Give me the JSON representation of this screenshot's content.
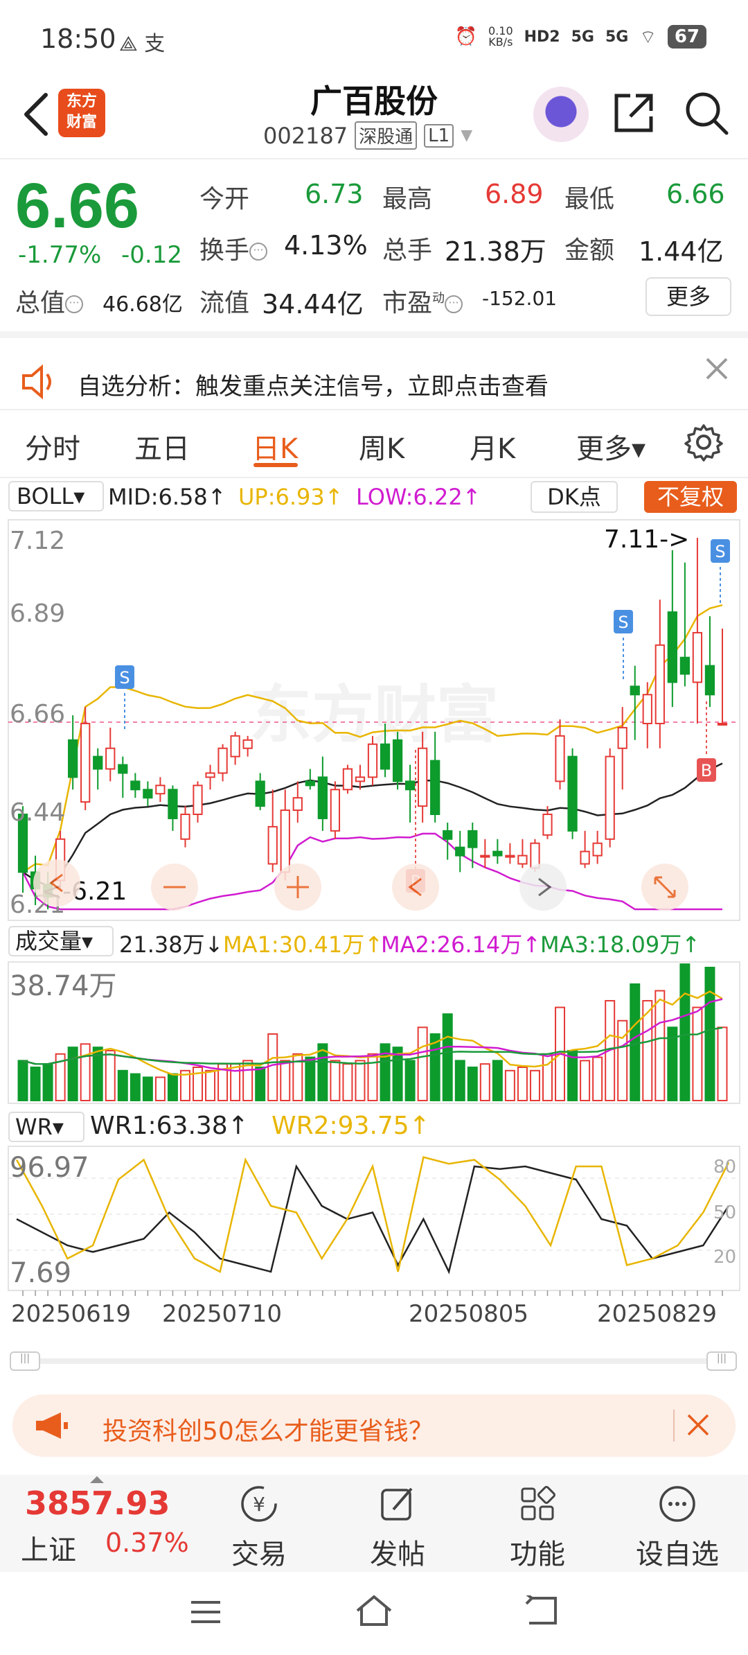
{
  "status_bar": {
    "time": "18:50",
    "left_icons": "⟁ 支",
    "net_speed_top": "0.10",
    "net_speed_bottom": "KB/s",
    "hd": "HD2",
    "sig1": "5G",
    "sig2": "5G",
    "battery": "67"
  },
  "header": {
    "logo_line1": "东方",
    "logo_line2": "财富",
    "title": "广百股份",
    "code": "002187",
    "market_tag": "深股通",
    "level_tag": "L1"
  },
  "quote": {
    "price": "6.66",
    "change_pct": "-1.77%",
    "change_abs": "-0.12",
    "open_label": "今开",
    "open_value": "6.73",
    "high_label": "最高",
    "high_value": "6.89",
    "low_label": "最低",
    "low_value": "6.66",
    "turnover_label": "换手",
    "turnover_value": "4.13%",
    "volume_label": "总手",
    "volume_value": "21.38万",
    "amount_label": "金额",
    "amount_value": "1.44亿",
    "mktcap_label": "总值",
    "mktcap_value": "46.68亿",
    "float_label": "流值",
    "float_value": "34.44亿",
    "pe_label": "市盈",
    "pe_sup": "动",
    "pe_value": "-152.01",
    "more_button": "更多"
  },
  "notice": {
    "text": "自选分析：触发重点关注信号，立即点击查看"
  },
  "tabs": [
    {
      "label": "分时"
    },
    {
      "label": "五日"
    },
    {
      "label": "日K"
    },
    {
      "label": "周K"
    },
    {
      "label": "月K"
    },
    {
      "label": "更多▾"
    }
  ],
  "indicator": {
    "boll_button": "BOLL▾",
    "mid": "MID:6.58↑",
    "up": "UP:6.93↑",
    "low": "LOW:6.22↑",
    "dk_button": "DK点",
    "nofq_button": "不复权",
    "boll_colors": {
      "mid": "#222222",
      "up": "#e8b500",
      "low": "#d01bd0"
    }
  },
  "kline": {
    "y_labels": [
      "7.12",
      "6.89",
      "6.66",
      "6.44",
      "6.21"
    ],
    "max_marker": "7.11->",
    "min_marker": "<-6.21",
    "watermark": "东方财富",
    "signal_s": "S",
    "signal_b": "B",
    "signal_p": "P"
  },
  "volume": {
    "selector": "成交量▾",
    "vol": "21.38万↓",
    "ma1": "MA1:30.41万↑",
    "ma2": "MA2:26.14万↑",
    "ma3": "MA3:18.09万↑",
    "y_max": "38.74万"
  },
  "wr": {
    "selector": "WR▾",
    "wr1": "WR1:63.38↑",
    "wr2": "WR2:93.75↑",
    "y_top": "96.97",
    "y_bottom": "7.69",
    "right_labels": [
      "80",
      "50",
      "20"
    ]
  },
  "dates": [
    "20250619",
    "20250710",
    "20250805",
    "20250829"
  ],
  "promo": {
    "text": "投资科创50怎么才能更省钱？"
  },
  "bottom_nav": {
    "index_value": "3857.93",
    "index_name": "上证",
    "index_change": "0.37%",
    "items": [
      {
        "label": "交易"
      },
      {
        "label": "发帖"
      },
      {
        "label": "功能"
      },
      {
        "label": "设自选"
      }
    ]
  },
  "chart_data": {
    "type": "candlestick",
    "y_range": [
      6.21,
      7.12
    ],
    "candles": [
      [
        6.44,
        6.3,
        6.46,
        6.25
      ],
      [
        6.3,
        6.26,
        6.34,
        6.22
      ],
      [
        6.27,
        6.24,
        6.3,
        6.21
      ],
      [
        6.28,
        6.38,
        6.4,
        6.26
      ],
      [
        6.62,
        6.53,
        6.68,
        6.5
      ],
      [
        6.47,
        6.66,
        6.7,
        6.45
      ],
      [
        6.58,
        6.55,
        6.6,
        6.5
      ],
      [
        6.55,
        6.6,
        6.65,
        6.52
      ],
      [
        6.56,
        6.54,
        6.58,
        6.48
      ],
      [
        6.52,
        6.5,
        6.54,
        6.48
      ],
      [
        6.5,
        6.48,
        6.52,
        6.46
      ],
      [
        6.49,
        6.51,
        6.53,
        6.47
      ],
      [
        6.5,
        6.43,
        6.51,
        6.4
      ],
      [
        6.38,
        6.44,
        6.46,
        6.36
      ],
      [
        6.44,
        6.51,
        6.52,
        6.42
      ],
      [
        6.53,
        6.54,
        6.56,
        6.5
      ],
      [
        6.54,
        6.6,
        6.61,
        6.52
      ],
      [
        6.58,
        6.63,
        6.64,
        6.56
      ],
      [
        6.6,
        6.62,
        6.63,
        6.58
      ],
      [
        6.52,
        6.46,
        6.54,
        6.45
      ],
      [
        6.32,
        6.41,
        6.5,
        6.3
      ],
      [
        6.3,
        6.45,
        6.5,
        6.28
      ],
      [
        6.45,
        6.48,
        6.52,
        6.42
      ],
      [
        6.52,
        6.51,
        6.55,
        6.5
      ],
      [
        6.53,
        6.43,
        6.58,
        6.4
      ],
      [
        6.4,
        6.5,
        6.52,
        6.38
      ],
      [
        6.5,
        6.55,
        6.56,
        6.49
      ],
      [
        6.52,
        6.53,
        6.56,
        6.5
      ],
      [
        6.53,
        6.61,
        6.63,
        6.51
      ],
      [
        6.61,
        6.55,
        6.66,
        6.53
      ],
      [
        6.62,
        6.52,
        6.64,
        6.5
      ],
      [
        6.52,
        6.5,
        6.56,
        6.42
      ],
      [
        6.46,
        6.6,
        6.64,
        6.42
      ],
      [
        6.57,
        6.44,
        6.64,
        6.42
      ],
      [
        6.4,
        6.38,
        6.42,
        6.33
      ],
      [
        6.36,
        6.34,
        6.4,
        6.3
      ],
      [
        6.4,
        6.36,
        6.42,
        6.31
      ],
      [
        6.34,
        6.34,
        6.38,
        6.31
      ],
      [
        6.35,
        6.34,
        6.38,
        6.32
      ],
      [
        6.34,
        6.34,
        6.37,
        6.32
      ],
      [
        6.32,
        6.34,
        6.38,
        6.31
      ],
      [
        6.31,
        6.37,
        6.38,
        6.3
      ],
      [
        6.39,
        6.44,
        6.46,
        6.38
      ],
      [
        6.52,
        6.63,
        6.67,
        6.5
      ],
      [
        6.58,
        6.4,
        6.6,
        6.38
      ],
      [
        6.32,
        6.35,
        6.4,
        6.31
      ],
      [
        6.34,
        6.37,
        6.4,
        6.32
      ],
      [
        6.38,
        6.58,
        6.6,
        6.36
      ],
      [
        6.6,
        6.65,
        6.7,
        6.5
      ],
      [
        6.75,
        6.73,
        6.8,
        6.62
      ],
      [
        6.66,
        6.73,
        6.76,
        6.6
      ],
      [
        6.66,
        6.85,
        6.96,
        6.6
      ],
      [
        6.93,
        6.76,
        7.08,
        6.7
      ],
      [
        6.82,
        6.78,
        7.05,
        6.75
      ],
      [
        6.76,
        6.88,
        7.11,
        6.66
      ],
      [
        6.8,
        6.73,
        6.92,
        6.7
      ],
      [
        6.66,
        6.66,
        6.89,
        6.66
      ]
    ],
    "volume_max": 38.74,
    "volumes": [
      12,
      10,
      11,
      14,
      16,
      17,
      16,
      15,
      9,
      8,
      7,
      7,
      8,
      9,
      10,
      9,
      11,
      11,
      12,
      10,
      20,
      12,
      14,
      13,
      17,
      12,
      11,
      12,
      14,
      17,
      16,
      12,
      22,
      20,
      26,
      12,
      10,
      11,
      12,
      9,
      10,
      9,
      14,
      28,
      15,
      12,
      13,
      30,
      24,
      35,
      30,
      33,
      22,
      41,
      28,
      40,
      22,
      21
    ],
    "wr1": [
      50,
      40,
      30,
      25,
      30,
      35,
      55,
      40,
      20,
      15,
      10,
      90,
      60,
      50,
      55,
      15,
      50,
      10,
      90,
      88,
      90,
      85,
      80,
      50,
      45,
      20,
      25,
      30,
      60
    ],
    "wr2": [
      95,
      60,
      20,
      30,
      80,
      95,
      50,
      20,
      10,
      95,
      60,
      55,
      20,
      50,
      90,
      10,
      97,
      92,
      95,
      80,
      60,
      30,
      90,
      90,
      15,
      20,
      30,
      55,
      93
    ]
  }
}
